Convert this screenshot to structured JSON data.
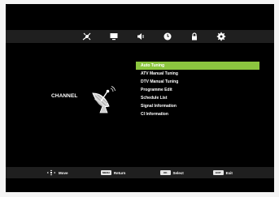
{
  "top_menu": {
    "icons": [
      "picture-icon",
      "channel-icon",
      "sound-icon",
      "time-icon",
      "lock-icon",
      "setup-icon"
    ]
  },
  "section": {
    "label": "CHANNEL",
    "icon": "satellite-dish-icon"
  },
  "channel_menu": {
    "items": [
      {
        "label": "Auto Tuning",
        "selected": true
      },
      {
        "label": "ATV Manual Tuning",
        "selected": false
      },
      {
        "label": "DTV Manual Tuning",
        "selected": false
      },
      {
        "label": "Programme Edit",
        "selected": false
      },
      {
        "label": "Schedule List",
        "selected": false
      },
      {
        "label": "Signal Information",
        "selected": false
      },
      {
        "label": "CI Information",
        "selected": false
      }
    ]
  },
  "help_bar": {
    "move": {
      "icon": "dpad-icon",
      "label": "Move"
    },
    "return": {
      "key": "MENU",
      "label": "Return"
    },
    "select": {
      "key": "OK",
      "label": "Select"
    },
    "exit": {
      "key": "EXIT",
      "label": "Exit"
    }
  },
  "colors": {
    "background": "#000000",
    "bar": "#1f1f1f",
    "highlight": "#8cc63f",
    "text": "#ffffff"
  }
}
